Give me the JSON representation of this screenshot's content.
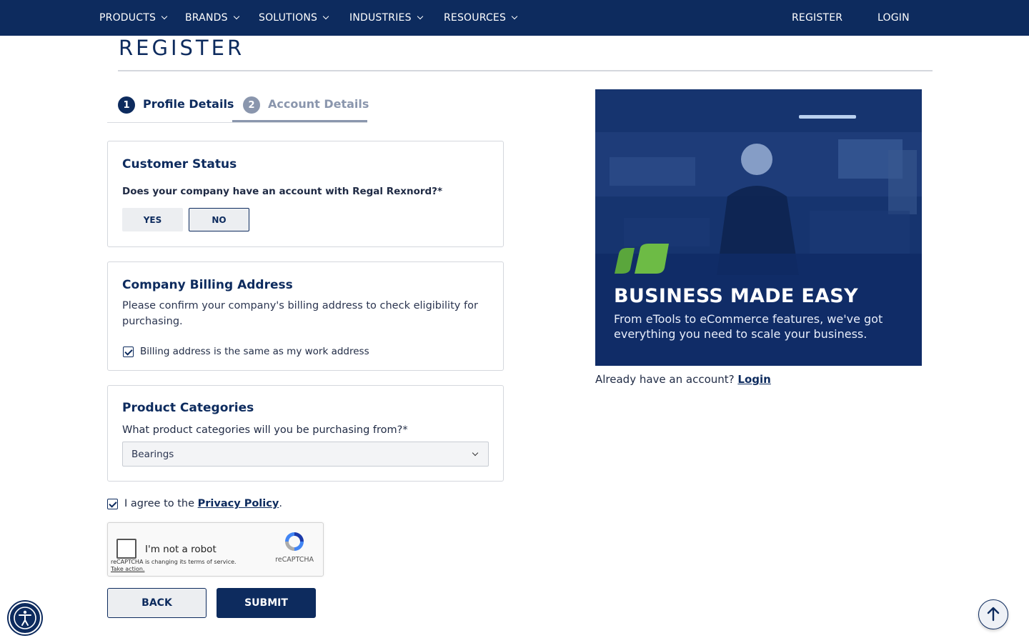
{
  "nav": {
    "items": [
      "PRODUCTS",
      "BRANDS",
      "SOLUTIONS",
      "INDUSTRIES",
      "RESOURCES"
    ],
    "register": "REGISTER",
    "login": "LOGIN"
  },
  "page": {
    "title": "REGISTER"
  },
  "steps": [
    {
      "number": "1",
      "label": "Profile Details",
      "state": "completed"
    },
    {
      "number": "2",
      "label": "Account Details",
      "state": "active"
    }
  ],
  "customer_status": {
    "heading": "Customer Status",
    "question": "Does your company have an account with Regal Rexnord?*",
    "yes_label": "YES",
    "no_label": "NO",
    "selected": "NO"
  },
  "billing": {
    "heading": "Company Billing Address",
    "description": "Please confirm your company's billing address to check eligibility for purchasing.",
    "same_address_label": "Billing address is the same as my work address",
    "same_address_checked": true
  },
  "categories": {
    "heading": "Product Categories",
    "question": "What product categories will you be purchasing from?*",
    "selected": "Bearings"
  },
  "privacy": {
    "prefix": "I agree to the ",
    "link": "Privacy Policy",
    "suffix": ".",
    "checked": true
  },
  "captcha": {
    "label": "I'm not a robot",
    "notice": "reCAPTCHA is changing its terms of service.",
    "action": "Take action.",
    "brand": "reCAPTCHA"
  },
  "buttons": {
    "back": "BACK",
    "submit": "SUBMIT"
  },
  "promo": {
    "headline": "BUSINESS MADE EASY",
    "subtext": "From eTools to eCommerce features, we've got everything you need to scale your business."
  },
  "login_prompt": {
    "text": "Already have an account? ",
    "link": "Login"
  },
  "colors": {
    "brand_navy": "#0d2b5e",
    "muted_step": "#8a96ad",
    "leaf_green": "#5aa63c"
  }
}
